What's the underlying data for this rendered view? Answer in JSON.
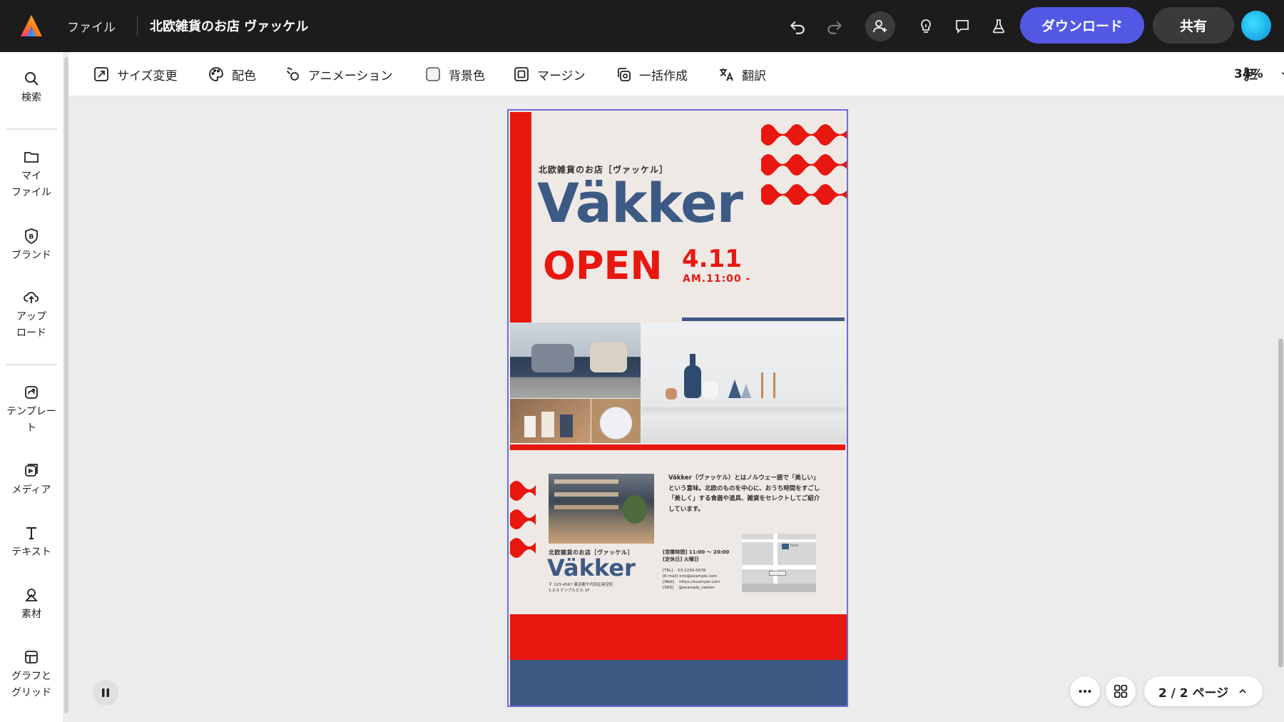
{
  "header": {
    "menu_file": "ファイル",
    "doc_title": "北欧雑貨のお店 ヴァッケル",
    "download_label": "ダウンロード",
    "share_label": "共有"
  },
  "sidebar": {
    "items": [
      {
        "label": "検索",
        "icon": "search-icon"
      },
      {
        "label": "マイ\nファイル",
        "icon": "folder-icon"
      },
      {
        "label": "ブランド",
        "icon": "brand-icon"
      },
      {
        "label": "アップ\nロード",
        "icon": "upload-icon"
      },
      {
        "label": "テンプレー\nト",
        "icon": "template-icon"
      },
      {
        "label": "メディア",
        "icon": "media-icon"
      },
      {
        "label": "テキスト",
        "icon": "text-icon"
      },
      {
        "label": "素材",
        "icon": "elements-icon"
      },
      {
        "label": "グラフと\nグリッド",
        "icon": "grid-icon"
      }
    ]
  },
  "toolbar": {
    "resize": "サイズ変更",
    "color": "配色",
    "animation": "アニメーション",
    "background": "背景色",
    "margin": "マージン",
    "bulk_create": "一括作成",
    "translate": "翻訳",
    "zoom": "34%"
  },
  "poster": {
    "shop_name_jp": "北欧雑貨のお店［ヴァッケル］",
    "brand": "Väkker",
    "open": "OPEN",
    "date": "4.11",
    "time": "AM.11:00 -",
    "description": "Väkker（ヴァッケル）とはノルウェー語で「美しい」という意味。北欧のものを中心に、おうち時間をすごし「美しく」する食器や道具、雑貨をセレクトしてご紹介しています。",
    "footer_shop_name": "北欧雑貨のお店［ヴァッケル］",
    "footer_brand": "Väkker",
    "address_line1": "〒 123-4567 東京都千代田区架空町",
    "address_line2": "1-2-3 テンプルビル 1F",
    "hours": "[営業時間] 11:00 〜 20:00",
    "closed": "[定休日] 火曜日",
    "tel": "[TEL]    03-1234-5678",
    "email": "[E-mail] info@example.com",
    "web": "[Web]    https://example.com",
    "sns": "[SNS]    @example_vakker",
    "map_label": "here",
    "colors": {
      "red": "#e8170f",
      "navy": "#3d5a85",
      "cream": "#efe9e6"
    }
  },
  "pager": {
    "label": "2 / 2 ページ"
  }
}
